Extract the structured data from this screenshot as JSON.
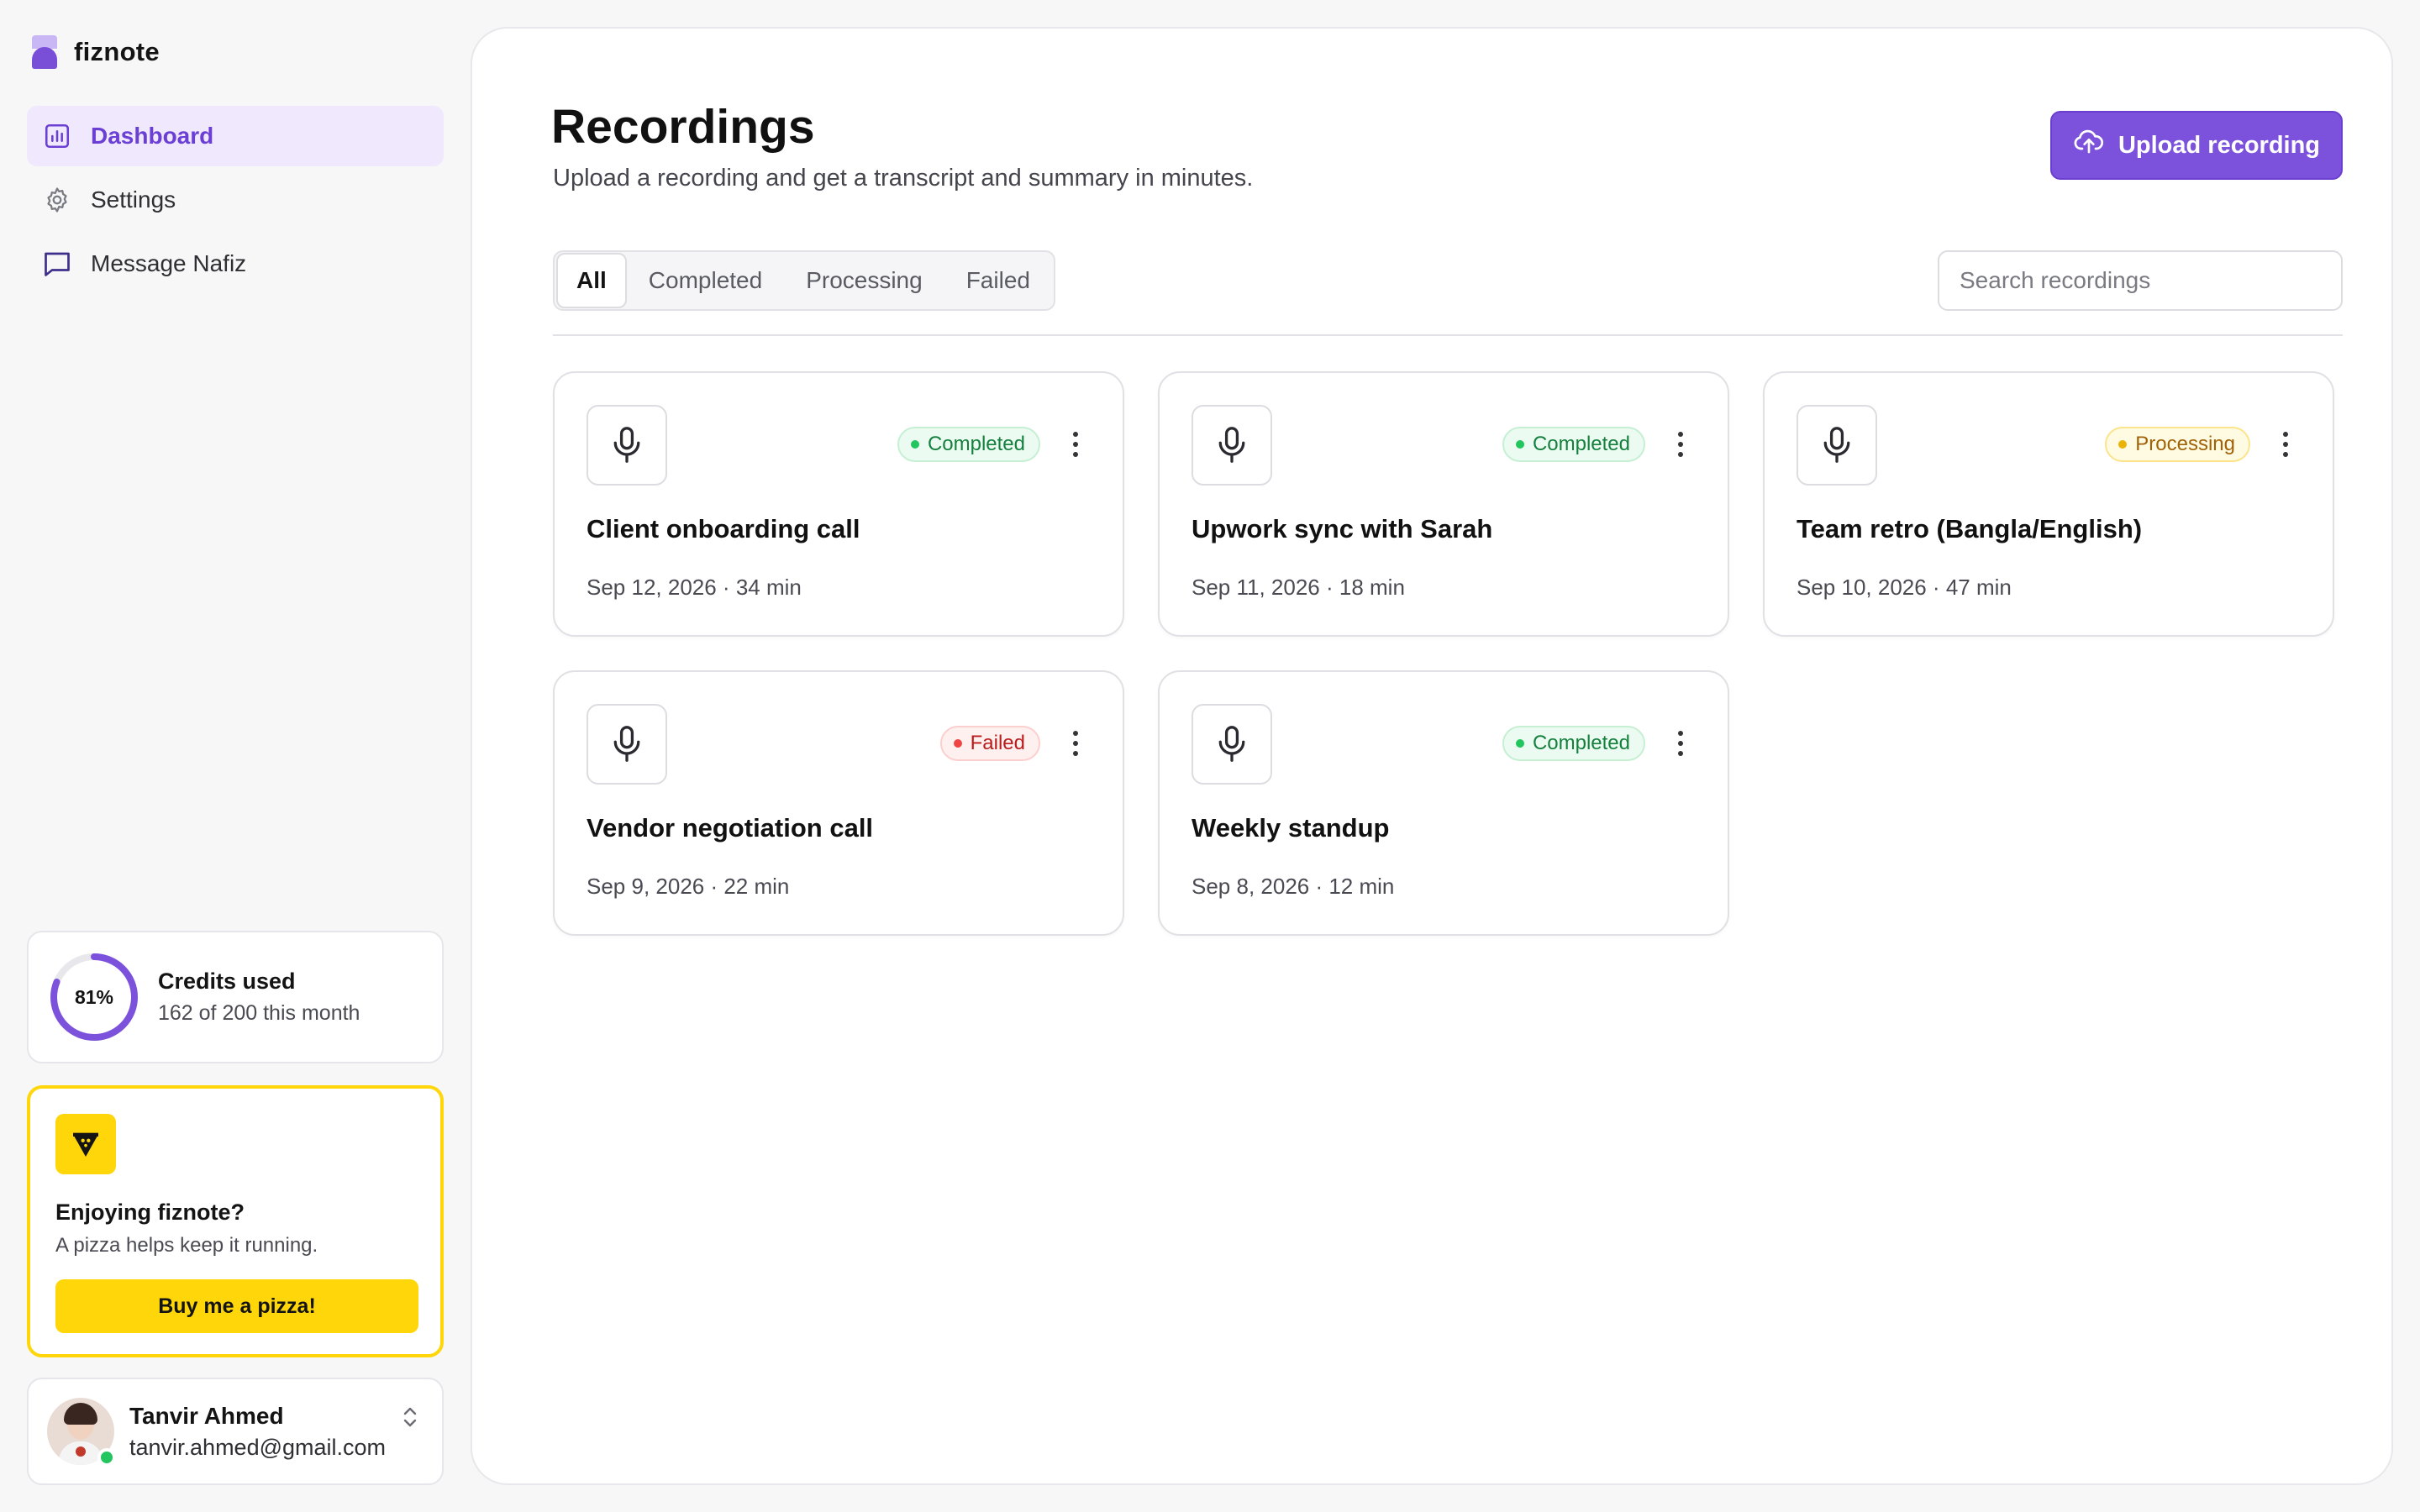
{
  "brand": {
    "name": "fiznote"
  },
  "nav": [
    {
      "label": "Dashboard",
      "icon": "bar-chart-icon",
      "active": true
    },
    {
      "label": "Settings",
      "icon": "gear-icon",
      "active": false
    },
    {
      "label": "Message Nafiz",
      "icon": "chat-bubble-icon",
      "active": false
    }
  ],
  "credits": {
    "percent_label": "81%",
    "percent": 81,
    "title": "Credits used",
    "subtitle": "162 of 200 this month"
  },
  "pizza": {
    "title": "Enjoying fiznote?",
    "subtitle": "A pizza helps keep it running.",
    "button_label": "Buy me a pizza!"
  },
  "user": {
    "name": "Tanvir Ahmed",
    "email": "tanvir.ahmed@gmail.com",
    "status": "online"
  },
  "header": {
    "title": "Recordings",
    "subtitle": "Upload a recording and get a transcript and summary in minutes.",
    "upload_label": "Upload recording"
  },
  "tabs": [
    {
      "label": "All",
      "active": true
    },
    {
      "label": "Completed",
      "active": false
    },
    {
      "label": "Processing",
      "active": false
    },
    {
      "label": "Failed",
      "active": false
    }
  ],
  "search": {
    "placeholder": "Search recordings",
    "value": ""
  },
  "recordings": [
    {
      "title": "Client onboarding call",
      "date": "Sep 12, 2026",
      "duration": "34 min",
      "status": "Completed"
    },
    {
      "title": "Upwork sync with Sarah",
      "date": "Sep 11, 2026",
      "duration": "18 min",
      "status": "Completed"
    },
    {
      "title": "Team retro (Bangla/English)",
      "date": "Sep 10, 2026",
      "duration": "47 min",
      "status": "Processing"
    },
    {
      "title": "Vendor negotiation call",
      "date": "Sep 9, 2026",
      "duration": "22 min",
      "status": "Failed"
    },
    {
      "title": "Weekly standup",
      "date": "Sep 8, 2026",
      "duration": "12 min",
      "status": "Completed"
    }
  ],
  "colors": {
    "accent": "#7c52dc",
    "accent_bg": "#f0e9fd",
    "pizza_yellow": "#ffd60a",
    "status_completed": "#22c55e",
    "status_processing": "#eab308",
    "status_failed": "#ef4444"
  }
}
